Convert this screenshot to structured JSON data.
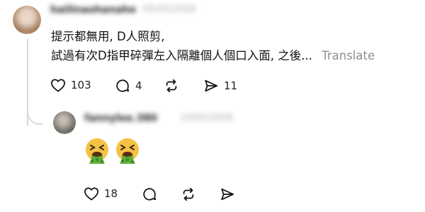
{
  "post": {
    "username": "hailinaohanahe",
    "timestamp": "05/05/2026",
    "line1": "提示都無用, D人照剪,",
    "line2": "試過有次D指甲碎彈左入隔離個人個口入面, 之後...",
    "translate_label": "Translate",
    "likes": "103",
    "comments": "4",
    "shares": "11"
  },
  "reply": {
    "username": "fannylee.380",
    "timestamp": "10/05/2026",
    "emoji": [
      "nauseated-face",
      "nauseated-face"
    ],
    "likes": "18"
  },
  "icons": [
    "heart-icon",
    "comment-icon",
    "repost-icon",
    "share-icon"
  ],
  "colors": {
    "text": "#111111",
    "muted": "#8e8e8e",
    "thread": "#d9d9d9",
    "emoji_face": "#f5c244",
    "vomit": "#5fae3a"
  }
}
